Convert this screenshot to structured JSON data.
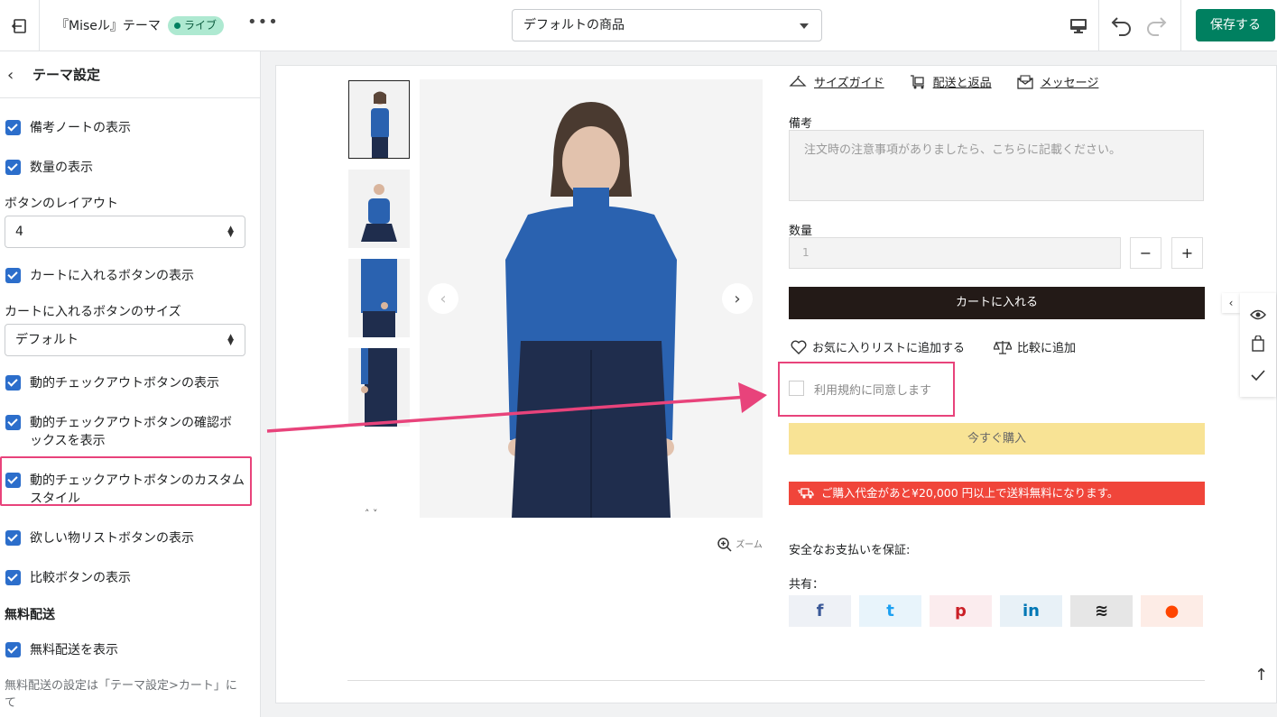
{
  "topbar": {
    "theme_name": "『Miseル』テーマ",
    "live_badge": "ライブ",
    "more": "•••",
    "template_select": "デフォルトの商品",
    "save_label": "保存する"
  },
  "sidebar": {
    "title": "テーマ設定",
    "items": {
      "show_note": "備考ノートの表示",
      "show_quantity": "数量の表示",
      "button_layout_label": "ボタンのレイアウト",
      "button_layout_value": "4",
      "show_cart_button": "カートに入れるボタンの表示",
      "cart_button_size_label": "カートに入れるボタンのサイズ",
      "cart_button_size_value": "デフォルト",
      "show_dynamic_checkout": "動的チェックアウトボタンの表示",
      "show_dynamic_checkout_confirm": "動的チェックアウトボタンの確認ボックスを表示",
      "dynamic_checkout_custom_style": "動的チェックアウトボタンのカスタムスタイル",
      "show_wishlist": "欲しい物リストボタンの表示",
      "show_compare": "比較ボタンの表示",
      "free_shipping_heading": "無料配送",
      "show_free_shipping": "無料配送を表示",
      "free_shipping_help": "無料配送の設定は「テーマ設定>カート」にて"
    }
  },
  "product": {
    "links": {
      "size_guide": "サイズガイド",
      "shipping": "配送と返品",
      "message": "メッセージ"
    },
    "note_label": "備考",
    "note_placeholder": "注文時の注意事項がありましたら、こちらに記載ください。",
    "qty_label": "数量",
    "qty_value": "1",
    "qty_minus": "−",
    "qty_plus": "+",
    "add_to_cart": "カートに入れる",
    "add_wishlist": "お気に入りリストに追加する",
    "add_compare": "比較に追加",
    "agree_terms": "利用規約に同意します",
    "buy_now": "今すぐ購入",
    "free_ship_bar": "ご購入代金があと¥20,000 円以上で送料無料になります。",
    "secure_payment": "安全なお支払いを保証:",
    "share_label": "共有：",
    "zoom": "ズーム"
  },
  "share_buttons": [
    {
      "name": "facebook",
      "glyph": "f",
      "bg": "#eef1f6",
      "color": "#3b5998"
    },
    {
      "name": "twitter",
      "glyph": "t",
      "bg": "#e8f4fb",
      "color": "#1da1f2"
    },
    {
      "name": "pinterest",
      "glyph": "p",
      "bg": "#fbecee",
      "color": "#cb2027"
    },
    {
      "name": "linkedin",
      "glyph": "in",
      "bg": "#e8f1f7",
      "color": "#0077b5"
    },
    {
      "name": "buffer",
      "glyph": "≋",
      "bg": "#e6e6e6",
      "color": "#222"
    },
    {
      "name": "reddit",
      "glyph": "●",
      "bg": "#fdece6",
      "color": "#ff4500"
    }
  ],
  "colors": {
    "accent": "#008060",
    "checkbox": "#2c6ecb",
    "highlight": "#e8437b",
    "cart_button": "#231a17",
    "buy_button": "#f8e395",
    "ship_bar": "#f0453a",
    "sweater": "#2a62b0"
  }
}
